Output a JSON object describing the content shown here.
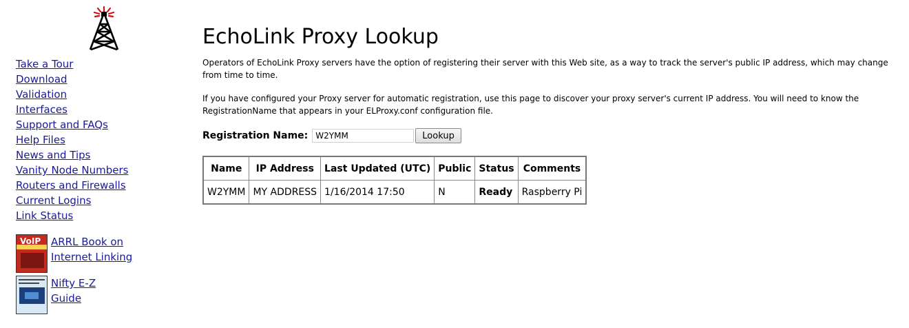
{
  "sidebar": {
    "logo": "echolink-tower-logo",
    "items": [
      {
        "label": "Take a Tour"
      },
      {
        "label": "Download"
      },
      {
        "label": "Validation"
      },
      {
        "label": "Interfaces"
      },
      {
        "label": "Support and FAQs"
      },
      {
        "label": "Help Files"
      },
      {
        "label": "News and Tips"
      },
      {
        "label": "Vanity Node Numbers"
      },
      {
        "label": "Routers and Firewalls"
      },
      {
        "label": "Current Logins"
      },
      {
        "label": "Link Status"
      }
    ],
    "books": [
      {
        "line1": "ARRL Book on",
        "line2": "Internet Linking",
        "cover_text": "VoIP"
      },
      {
        "line1": "Nifty E-Z",
        "line2": "Guide"
      }
    ]
  },
  "main": {
    "title": "EchoLink Proxy Lookup",
    "para1": "Operators of EchoLink Proxy servers have the option of registering their server with this Web site, as a way to track the server's public IP address, which may change from time to time.",
    "para2": "If you have configured your Proxy server for automatic registration, use this page to discover your proxy server's current IP address.  You will need to know the RegistrationName that appears in your ELProxy.conf configuration file.",
    "form": {
      "label": "Registration Name:",
      "value": "W2YMM",
      "button": "Lookup"
    },
    "table": {
      "headers": [
        "Name",
        "IP Address",
        "Last Updated (UTC)",
        "Public",
        "Status",
        "Comments"
      ],
      "rows": [
        [
          "W2YMM",
          "MY ADDRESS",
          "1/16/2014 17:50",
          "N",
          "Ready",
          "Raspberry Pi"
        ]
      ]
    }
  },
  "colors": {
    "link": "#1a1a99",
    "logo_red": "#cc1111"
  }
}
